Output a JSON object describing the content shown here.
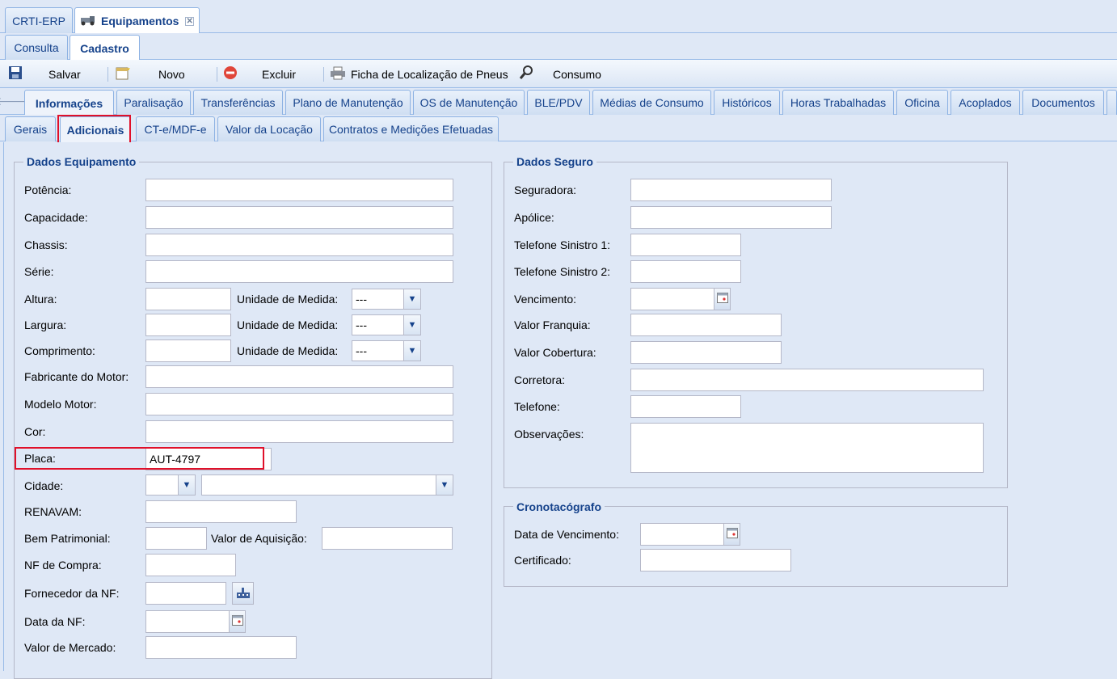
{
  "app_tabs": [
    {
      "label": "CRTI-ERP"
    },
    {
      "label": "Equipamentos",
      "icon": "vehicle-icon",
      "closable": true
    }
  ],
  "mode_tabs": [
    {
      "label": "Consulta"
    },
    {
      "label": "Cadastro"
    }
  ],
  "toolbar": {
    "save_label": "Salvar",
    "new_label": "Novo",
    "delete_label": "Excluir",
    "tire_label": "Ficha de Localização de Pneus",
    "consumption_label": "Consumo"
  },
  "section_tabs": [
    "Informações",
    "Paralisação",
    "Transferências",
    "Plano de Manutenção",
    "OS de Manutenção",
    "BLE/PDV",
    "Médias de Consumo",
    "Históricos",
    "Horas Trabalhadas",
    "Oficina",
    "Acoplados",
    "Documentos"
  ],
  "sub_tabs": [
    "Gerais",
    "Adicionais",
    "CT-e/MDF-e",
    "Valor da Locação",
    "Contratos e Medições Efetuadas"
  ],
  "equipamento": {
    "legend": "Dados Equipamento",
    "potencia": "Potência:",
    "capacidade": "Capacidade:",
    "chassis": "Chassis:",
    "serie": "Série:",
    "altura": "Altura:",
    "largura": "Largura:",
    "comprimento": "Comprimento:",
    "unidade": "Unidade de Medida:",
    "unidade_value": "---",
    "fabricante": "Fabricante do Motor:",
    "modelo": "Modelo Motor:",
    "cor": "Cor:",
    "placa": "Placa:",
    "placa_value": "AUT-4797",
    "cidade": "Cidade:",
    "renavam": "RENAVAM:",
    "bem": "Bem Patrimonial:",
    "valor_aquisicao": "Valor de Aquisição:",
    "nf_compra": "NF de Compra:",
    "fornecedor": "Fornecedor da NF:",
    "data_nf": "Data da NF:",
    "valor_mercado": "Valor de Mercado:"
  },
  "seguro": {
    "legend": "Dados Seguro",
    "seguradora": "Seguradora:",
    "apolice": "Apólice:",
    "tel1": "Telefone Sinistro 1:",
    "tel2": "Telefone Sinistro 2:",
    "vencimento": "Vencimento:",
    "franquia": "Valor Franquia:",
    "cobertura": "Valor Cobertura:",
    "corretora": "Corretora:",
    "telefone": "Telefone:",
    "observacoes": "Observações:"
  },
  "crono": {
    "legend": "Cronotacógrafo",
    "data_venc": "Data de Vencimento:",
    "certificado": "Certificado:"
  },
  "colors": {
    "accent": "#15428b",
    "highlight": "#e0102a",
    "panel": "#dfe8f6"
  }
}
